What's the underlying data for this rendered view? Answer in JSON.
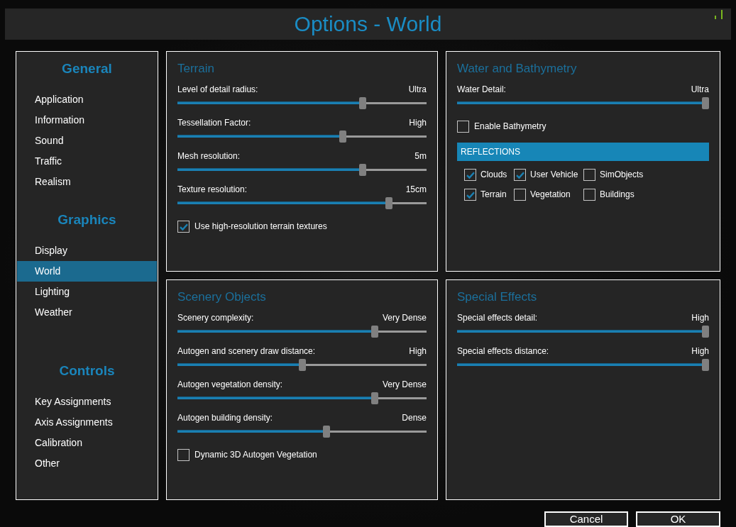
{
  "window": {
    "title": "Options - World"
  },
  "sidebar": {
    "sections": [
      {
        "heading": "General",
        "items": [
          {
            "label": "Application",
            "selected": false
          },
          {
            "label": "Information",
            "selected": false
          },
          {
            "label": "Sound",
            "selected": false
          },
          {
            "label": "Traffic",
            "selected": false
          },
          {
            "label": "Realism",
            "selected": false
          }
        ]
      },
      {
        "heading": "Graphics",
        "items": [
          {
            "label": "Display",
            "selected": false
          },
          {
            "label": "World",
            "selected": true
          },
          {
            "label": "Lighting",
            "selected": false
          },
          {
            "label": "Weather",
            "selected": false
          }
        ]
      },
      {
        "heading": "Controls",
        "items": [
          {
            "label": "Key Assignments",
            "selected": false
          },
          {
            "label": "Axis Assignments",
            "selected": false
          },
          {
            "label": "Calibration",
            "selected": false
          },
          {
            "label": "Other",
            "selected": false
          }
        ]
      }
    ]
  },
  "panels": [
    {
      "title": "Terrain",
      "controls": [
        {
          "kind": "slider",
          "label": "Level of detail radius:",
          "reading": "Ultra",
          "level": 0.75
        },
        {
          "kind": "slider",
          "label": "Tessellation Factor:",
          "reading": "High",
          "level": 0.67
        },
        {
          "kind": "slider",
          "label": "Mesh resolution:",
          "reading": "5m",
          "level": 0.75
        },
        {
          "kind": "slider",
          "label": "Texture resolution:",
          "reading": "15cm",
          "level": 0.86
        },
        {
          "kind": "checkbox",
          "label": "Use high-resolution terrain textures",
          "checked": true
        }
      ]
    },
    {
      "title": "Water and Bathymetry",
      "controls": [
        {
          "kind": "slider",
          "label": "Water Detail:",
          "reading": "Ultra",
          "level": 1
        },
        {
          "kind": "checkbox",
          "label": "Enable Bathymetry",
          "checked": false
        },
        {
          "kind": "group",
          "heading": "REFLECTIONS",
          "options": [
            {
              "label": "Clouds",
              "checked": true
            },
            {
              "label": "User Vehicle",
              "checked": true
            },
            {
              "label": "SimObjects",
              "checked": false
            },
            {
              "label": "Terrain",
              "checked": true
            },
            {
              "label": "Vegetation",
              "checked": false
            },
            {
              "label": "Buildings",
              "checked": false
            }
          ]
        }
      ]
    },
    {
      "title": "Scenery Objects",
      "controls": [
        {
          "kind": "slider",
          "label": "Scenery complexity:",
          "reading": "Very Dense",
          "level": 0.8
        },
        {
          "kind": "slider",
          "label": "Autogen and scenery draw distance:",
          "reading": "High",
          "level": 0.5
        },
        {
          "kind": "slider",
          "label": "Autogen vegetation density:",
          "reading": "Very Dense",
          "level": 0.8
        },
        {
          "kind": "slider",
          "label": "Autogen building density:",
          "reading": "Dense",
          "level": 0.6
        },
        {
          "kind": "checkbox",
          "label": "Dynamic 3D Autogen Vegetation",
          "checked": false
        }
      ]
    },
    {
      "title": "Special Effects",
      "controls": [
        {
          "kind": "slider",
          "label": "Special effects detail:",
          "reading": "High",
          "level": 1
        },
        {
          "kind": "slider",
          "label": "Special effects distance:",
          "reading": "High",
          "level": 1
        }
      ]
    }
  ],
  "buttons": [
    "Cancel",
    "OK"
  ]
}
